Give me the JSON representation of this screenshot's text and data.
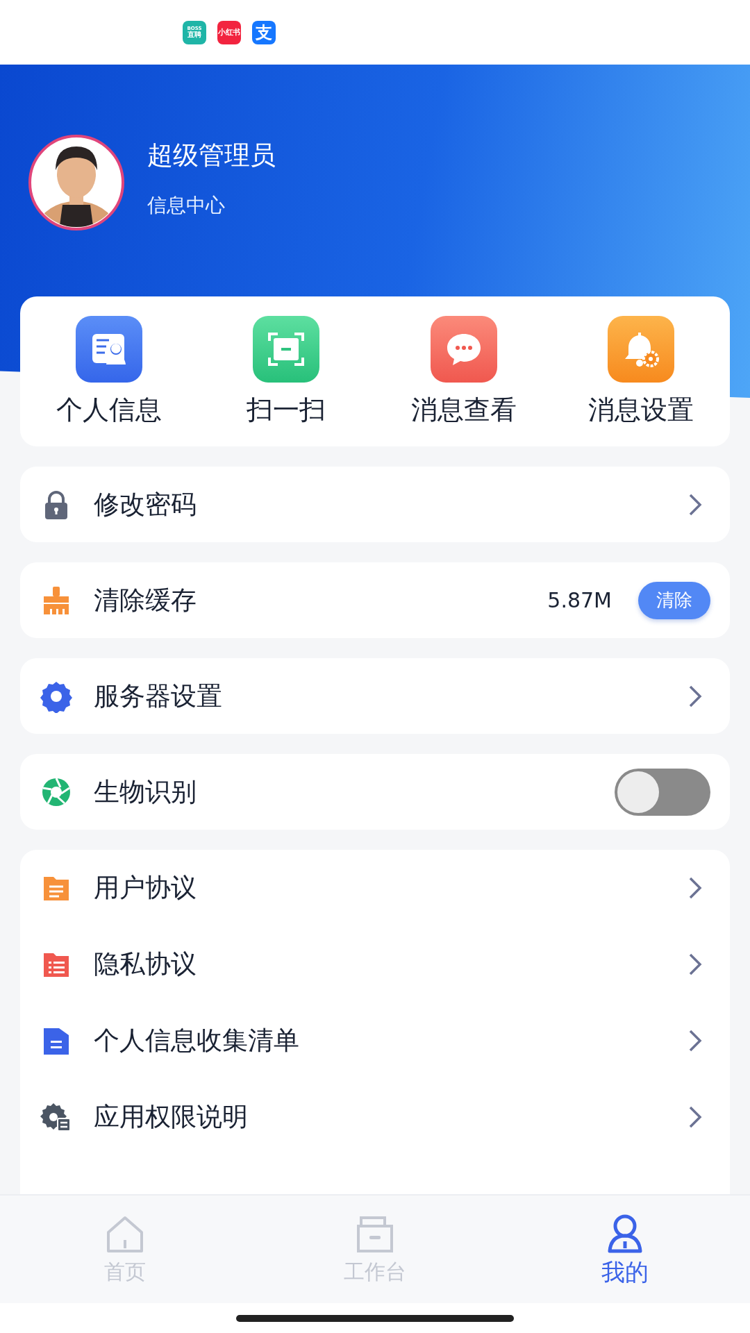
{
  "status_bar": {
    "notification_icons": [
      {
        "kind": "boss",
        "lines": [
          "BOSS",
          "直聘"
        ]
      },
      {
        "kind": "redbook",
        "lines": [
          "小红书"
        ]
      },
      {
        "kind": "alipay",
        "lines": [
          "支"
        ]
      }
    ]
  },
  "profile": {
    "name": "超级管理员",
    "subtitle": "信息中心"
  },
  "shortcuts": [
    {
      "kind": "profile",
      "label": "个人信息"
    },
    {
      "kind": "scan",
      "label": "扫一扫"
    },
    {
      "kind": "message",
      "label": "消息查看"
    },
    {
      "kind": "bell",
      "label": "消息设置"
    }
  ],
  "settings": [
    {
      "kind": "link",
      "label": "修改密码"
    },
    {
      "kind": "cache",
      "label": "清除缓存",
      "value": "5.87M",
      "button": "清除"
    },
    {
      "kind": "link",
      "label": "服务器设置"
    },
    {
      "kind": "toggle",
      "label": "生物识别",
      "on": false
    }
  ],
  "documents": [
    {
      "kind": "doc",
      "color": "#f7913a",
      "label": "用户协议"
    },
    {
      "kind": "list",
      "color": "#f0584f",
      "label": "隐私协议"
    },
    {
      "kind": "folder",
      "color": "#3b63e8",
      "label": "个人信息收集清单"
    },
    {
      "kind": "gear-doc",
      "color": "#4b5563",
      "label": "应用权限说明"
    }
  ],
  "tabs": [
    {
      "kind": "home",
      "label": "首页",
      "selected": false
    },
    {
      "kind": "box",
      "label": "工作台",
      "selected": false
    },
    {
      "kind": "person",
      "label": "我的",
      "selected": true
    }
  ]
}
